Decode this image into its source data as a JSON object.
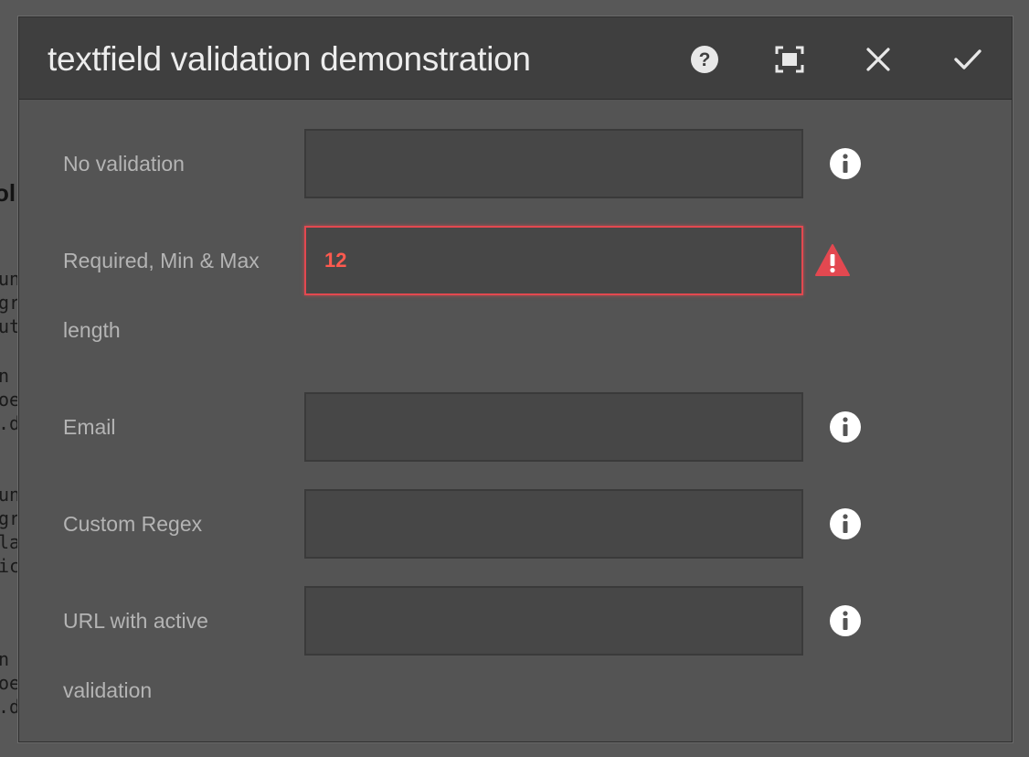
{
  "dialog": {
    "title": "textfield validation demonstration"
  },
  "header_buttons": {
    "help_icon": "question-circle-icon",
    "fullscreen_icon": "fullscreen-icon",
    "close_icon": "close-icon",
    "done_icon": "checkmark-icon"
  },
  "fields": [
    {
      "label_line1": "No validation",
      "label_line2": "",
      "value": "",
      "status": "info",
      "status_icon": "info-icon"
    },
    {
      "label_line1": "Required, Min & Max",
      "label_line2": "length",
      "value": "12",
      "status": "error",
      "status_icon": "alert-icon"
    },
    {
      "label_line1": "Email",
      "label_line2": "",
      "value": "",
      "status": "info",
      "status_icon": "info-icon"
    },
    {
      "label_line1": "Custom Regex",
      "label_line2": "",
      "value": "",
      "status": "info",
      "status_icon": "info-icon"
    },
    {
      "label_line1": "URL with active",
      "label_line2": "validation",
      "value": "",
      "status": "info",
      "status_icon": "info-icon"
    }
  ],
  "colors": {
    "dialog_bg": "#545454",
    "header_bg": "#3f3f3f",
    "error": "#e34850",
    "icon": "#ffffff"
  }
}
